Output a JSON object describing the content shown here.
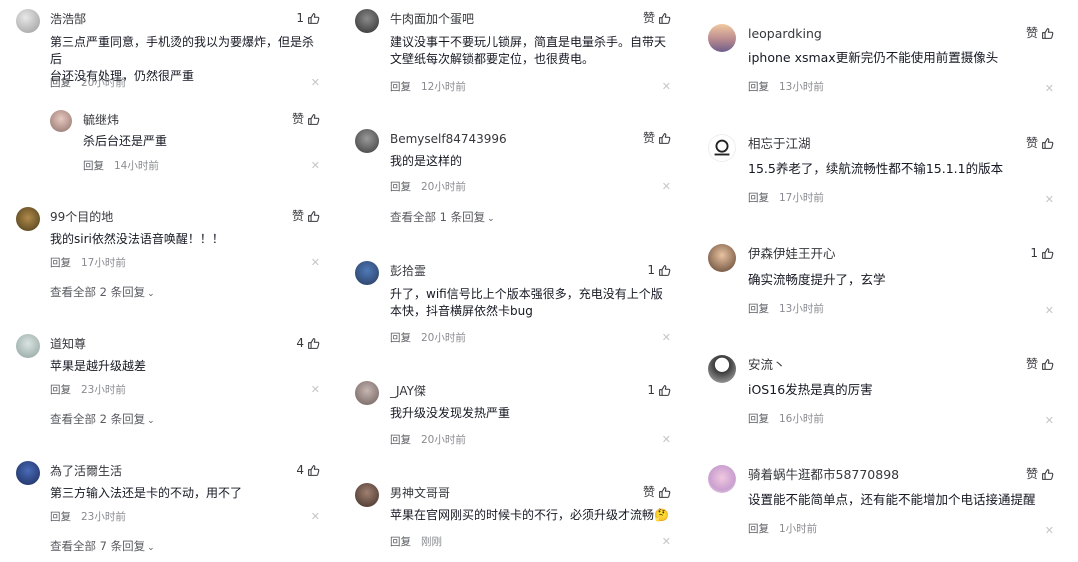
{
  "icons": {
    "like": "thumb-up-icon",
    "close": "close-icon",
    "chevron": "chevron-down-icon"
  },
  "reply_label": "回复",
  "columns": [
    {
      "comments": [
        {
          "user": "浩浩郜",
          "likes": "1",
          "text_lines": [
            "第三点严重同意，手机烫的我以为要爆炸，但是杀后",
            "台还没有处理，仍然很严重"
          ],
          "time": "20小时前",
          "replies": [
            {
              "user": "毓继炜",
              "likes": "赞",
              "text": "杀后台还是严重",
              "time": "14小时前"
            }
          ]
        },
        {
          "user": "99个目的地",
          "likes": "赞",
          "text_lines": [
            "我的siri依然没法语音唤醒！！！"
          ],
          "time": "17小时前",
          "more": "查看全部 2 条回复"
        },
        {
          "user": "道知尊",
          "likes": "4",
          "text_lines": [
            "苹果是越升级越差"
          ],
          "time": "23小时前",
          "more": "查看全部 2 条回复"
        },
        {
          "user": "為了活爾生活",
          "likes": "4",
          "text_lines": [
            "第三方输入法还是卡的不动，用不了"
          ],
          "time": "23小时前",
          "more": "查看全部 7 条回复"
        }
      ]
    },
    {
      "comments": [
        {
          "user": "牛肉面加个蛋吧",
          "likes": "赞",
          "text_lines": [
            "建议没事干不要玩儿锁屏，简直是电量杀手。自带天",
            "文壁纸每次解锁都要定位，也很费电。"
          ],
          "time": "12小时前"
        },
        {
          "user": "Bemyself84743996",
          "likes": "赞",
          "text_lines": [
            "我的是这样的"
          ],
          "time": "20小时前",
          "more": "查看全部 1 条回复"
        },
        {
          "user": "彭拾霊",
          "likes": "1",
          "text_lines": [
            "升了，wifi信号比上个版本强很多，充电没有上个版",
            "本快，抖音横屏依然卡bug"
          ],
          "time": "20小时前"
        },
        {
          "user": "_JAY傑",
          "likes": "1",
          "text_lines": [
            "我升级没发现发热严重"
          ],
          "time": "20小时前"
        },
        {
          "user": "男神文哥哥",
          "likes": "赞",
          "text_lines": [
            "苹果在官网刚买的时候卡的不行，必须升级才流畅🤔"
          ],
          "time": "刚刚"
        }
      ]
    },
    {
      "comments": [
        {
          "user": "leopardking",
          "likes": "赞",
          "text_lines": [
            "iphone xsmax更新完仍不能使用前置摄像头"
          ],
          "time": "13小时前"
        },
        {
          "user": "相忘于江湖",
          "likes": "赞",
          "text_lines": [
            "15.5养老了，续航流畅性都不输15.1.1的版本"
          ],
          "time": "17小时前"
        },
        {
          "user": "伊森伊娃王开心",
          "likes": "1",
          "text_lines": [
            "确实流畅度提升了，玄学"
          ],
          "time": "13小时前"
        },
        {
          "user": "安流丶",
          "likes": "赞",
          "text_lines": [
            "iOS16发热是真的厉害"
          ],
          "time": "16小时前"
        },
        {
          "user": "骑着蜗牛逛都市58770898",
          "likes": "赞",
          "text_lines": [
            "设置能不能简单点，还有能不能增加个电话接通提醒"
          ],
          "time": "1小时前"
        }
      ]
    }
  ]
}
